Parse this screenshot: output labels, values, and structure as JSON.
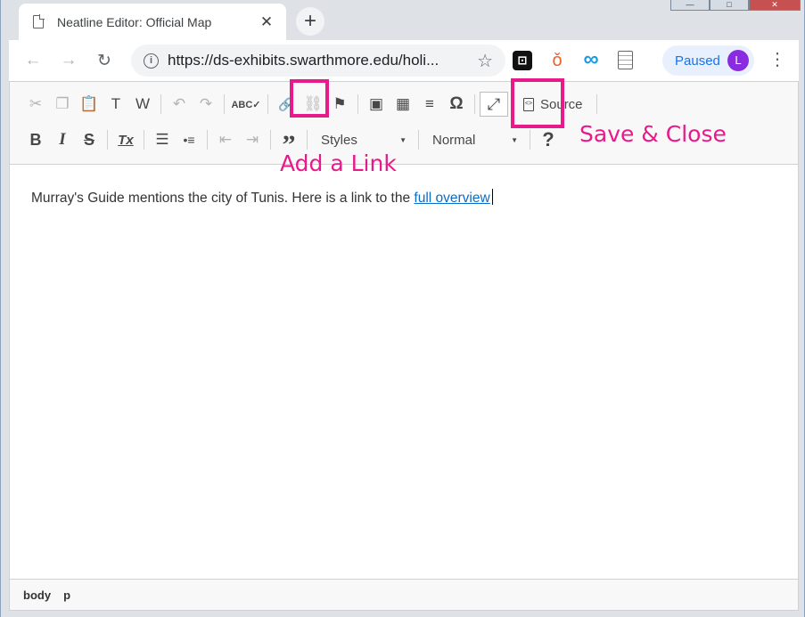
{
  "browser": {
    "window_controls": [
      "—",
      "□",
      "✕"
    ],
    "tab": {
      "title": "Neatline Editor: Official Map",
      "close": "✕"
    },
    "new_tab": "+",
    "nav": {
      "back": "←",
      "forward": "→",
      "reload": "↻"
    },
    "url": "https://ds-exhibits.swarthmore.edu/holi...",
    "star": "☆",
    "profile": {
      "label": "Paused",
      "initial": "L"
    },
    "menu": "⋮"
  },
  "toolbar": {
    "row1": {
      "cut": "✂",
      "copy": "❐",
      "paste": "📋",
      "paste_text": "T",
      "paste_word": "W",
      "undo": "↶",
      "redo": "↷",
      "spellcheck": "ABC✓",
      "link": "🔗",
      "unlink": "⛓",
      "anchor": "⚑",
      "image": "▣",
      "table": "▦",
      "hline": "≡",
      "special_char": "Ω",
      "maximize": "⤢",
      "source_label": "Source"
    },
    "row2": {
      "bold": "B",
      "italic": "I",
      "strike": "S",
      "remove_format": "Tx",
      "numbered_list": "☰",
      "bulleted_list": "•≡",
      "outdent": "⇤",
      "indent": "⇥",
      "blockquote": "”",
      "styles_label": "Styles",
      "format_label": "Normal",
      "help": "?"
    }
  },
  "content": {
    "text": "Murray's Guide mentions the city of Tunis. Here is a link to the ",
    "link_text": "full overview"
  },
  "statusbar": {
    "path": [
      "body",
      "p"
    ]
  },
  "annotations": {
    "link_label": "Add a Link",
    "save_label": "Save & Close",
    "color": "#e8198b"
  }
}
